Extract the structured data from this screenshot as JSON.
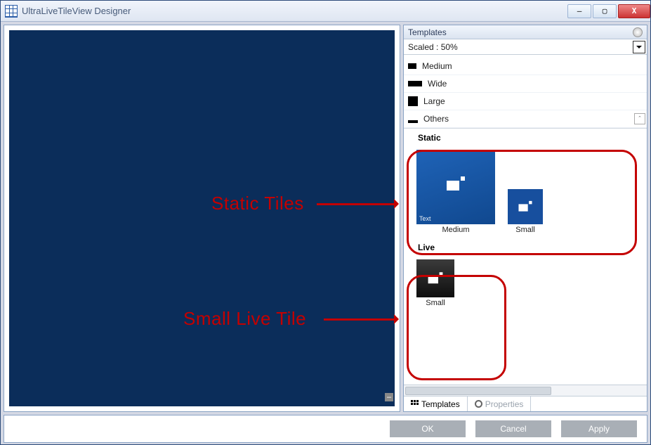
{
  "window": {
    "title": "UltraLiveTileView Designer"
  },
  "panel": {
    "header": "Templates",
    "scale": "Scaled : 50%",
    "sizes": {
      "medium": "Medium",
      "wide": "Wide",
      "large": "Large",
      "others": "Others"
    },
    "groups": {
      "static": "Static",
      "live": "Live"
    },
    "tiles": {
      "static_medium": {
        "caption": "Medium",
        "inner_text": "Text"
      },
      "static_small": {
        "caption": "Small"
      },
      "live_small": {
        "caption": "Small"
      }
    }
  },
  "tabs": {
    "templates": "Templates",
    "properties": "Properties"
  },
  "buttons": {
    "ok": "OK",
    "cancel": "Cancel",
    "apply": "Apply"
  },
  "annotations": {
    "static": "Static Tiles",
    "live": "Small Live Tile"
  }
}
